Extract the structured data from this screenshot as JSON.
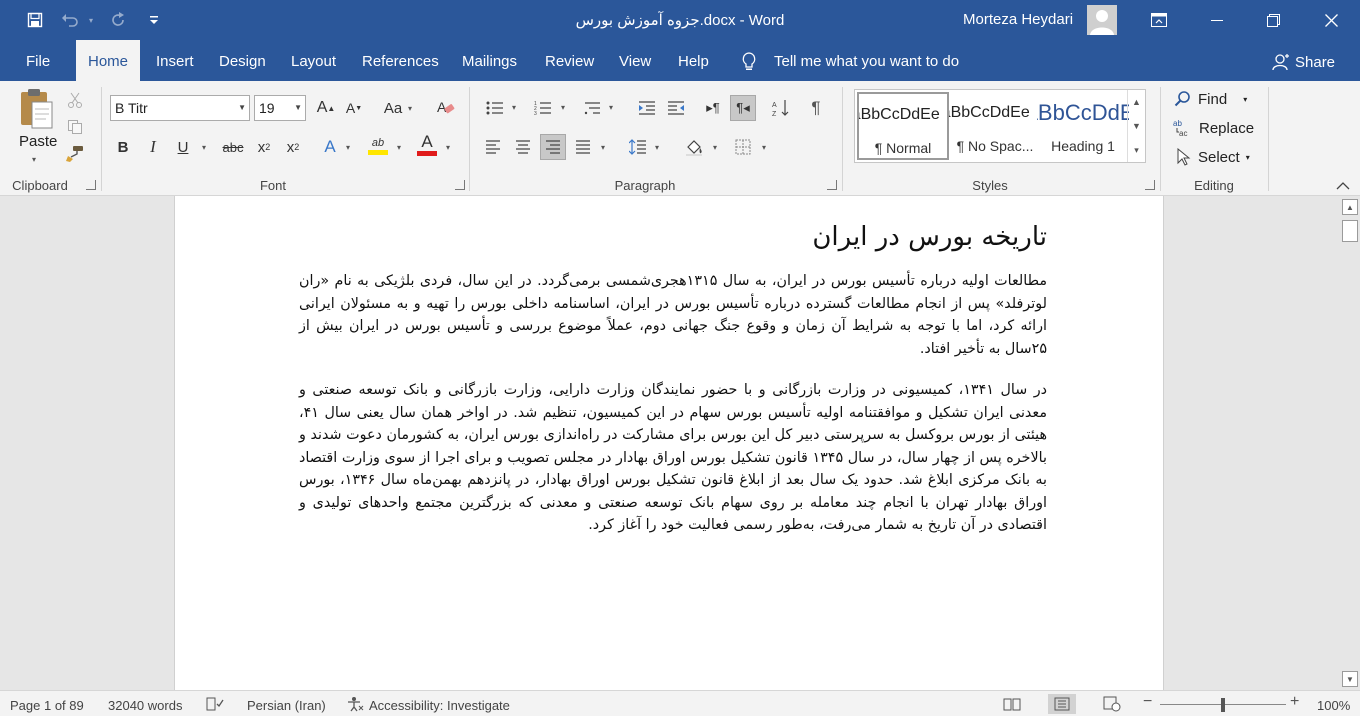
{
  "title_bar": {
    "document_title": "جزوه آموزش بورس.docx  -  Word",
    "user_name": "Morteza Heydari",
    "icons": [
      "save-icon",
      "undo-icon",
      "redo-icon",
      "customize-qat-icon",
      "ribbon-display-icon",
      "minimize-icon",
      "restore-icon",
      "close-icon"
    ]
  },
  "tabs": [
    "File",
    "Home",
    "Insert",
    "Design",
    "Layout",
    "References",
    "Mailings",
    "Review",
    "View",
    "Help"
  ],
  "active_tab": "Home",
  "tell_me": "Tell me what you want to do",
  "share_label": "Share",
  "ribbon": {
    "clipboard": {
      "label": "Clipboard",
      "paste_label": "Paste"
    },
    "font": {
      "label": "Font",
      "font_name": "B Titr",
      "font_size": "19",
      "change_case": "Aa",
      "grow": "A",
      "shrink": "A",
      "bold": "B",
      "italic": "I",
      "underline": "U",
      "strike": "abc",
      "subscript": "x",
      "superscript": "x",
      "highlight": "ab",
      "font_color": "A",
      "text_effects": "A"
    },
    "paragraph": {
      "label": "Paragraph"
    },
    "styles": {
      "label": "Styles",
      "items": [
        {
          "sample": "AaBbCcDdEe",
          "name": "¶ Normal"
        },
        {
          "sample": "AaBbCcDdEe",
          "name": "¶ No Spac..."
        },
        {
          "sample": "AaBbCcDdEe",
          "name": "Heading 1"
        }
      ]
    },
    "editing": {
      "label": "Editing",
      "find": "Find",
      "replace": "Replace",
      "select": "Select"
    }
  },
  "document": {
    "heading": "تاریخه بورس در ایران",
    "paragraphs": [
      "مطالعات اولیه درباره تأسیس بورس در ایران، به سال ۱۳۱۵هجری‌شمسی برمی‌گردد. در این سال، فردی بلژیکی به نام «ران لوترفلد» پس از انجام مطالعات گسترده درباره تأسیس بورس در ایران، اساسنامه داخلی بورس را تهیه و به مسئولان ایرانی ارائه کرد، اما با توجه به شرایط آن زمان و وقوع جنگ جهانی دوم، عملاً موضوع بررسی و تأسیس بورس در ایران بیش از ۲۵سال به تأخیر افتاد.",
      "در سال ۱۳۴۱، کمیسیونی در وزارت بازرگانی و با حضور نمایندگان وزارت دارایی، وزارت بازرگانی و بانک توسعه صنعتی و معدنی ایران تشکیل و موافقتنامه اولیه تأسیس بورس سهام در این کمیسیون، تنظیم شد. در اواخر همان سال یعنی سال ۴۱، هیئتی از بورس بروکسل به سرپرستی دبیر کل این بورس برای مشارکت در راه‌اندازی بورس ایران، به کشورمان دعوت شدند و بالاخره پس از چهار سال، در سال ۱۳۴۵ قانون تشکیل بورس اوراق بهادار در مجلس تصویب و برای اجرا از سوی وزارت اقتصاد به بانک مرکزی ابلاغ شد. حدود یک سال بعد از ابلاغ قانون تشکیل بورس اوراق بهادار، در پانزدهم بهمن‌ماه سال ۱۳۴۶، بورس اوراق بهادار تهران با انجام چند معامله بر روی سهام بانک توسعه صنعتی و معدنی که بزرگترین مجتمع واحدهای تولیدی و اقتصادی در آن تاریخ به شمار می‌رفت، به‌طور رسمی فعالیت خود را آغاز کرد."
    ]
  },
  "status_bar": {
    "page": "Page 1 of 89",
    "words": "32040 words",
    "language": "Persian (Iran)",
    "accessibility": "Accessibility: Investigate",
    "zoom": "100%",
    "zoom_fraction": 0.5
  },
  "colors": {
    "title_bar": "#2b579a",
    "ribbon_bg": "#f3f3f3",
    "highlight": "#ffe600",
    "font_color": "#e01b1b"
  }
}
